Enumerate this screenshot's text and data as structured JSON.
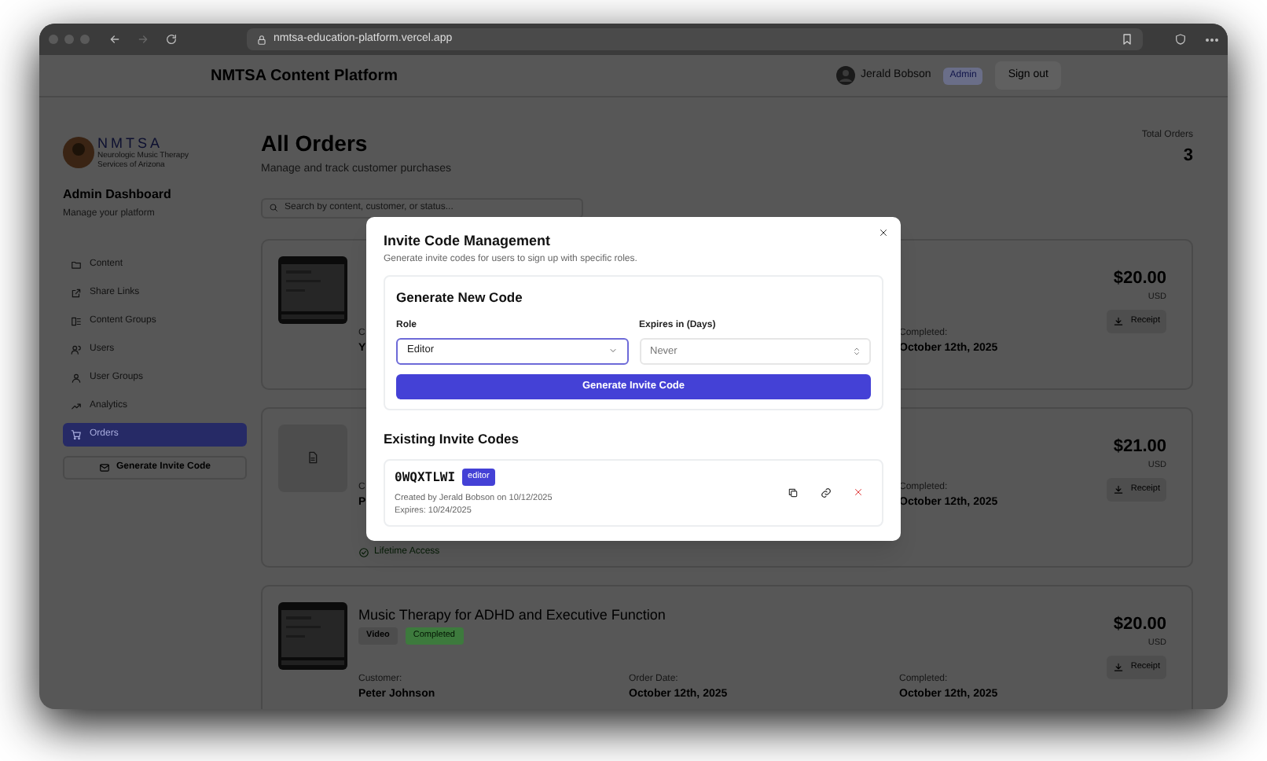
{
  "browser": {
    "url": "nmtsa-education-platform.vercel.app"
  },
  "header": {
    "title": "NMTSA Content Platform",
    "user_name": "Jerald Bobson",
    "role_badge": "Admin",
    "sign_out": "Sign out"
  },
  "sidebar": {
    "logo_text": "NMTSA",
    "logo_subtitle": "Neurologic Music Therapy Services of Arizona",
    "title": "Admin Dashboard",
    "subtitle": "Manage your platform",
    "nav": [
      {
        "label": "Content",
        "selected": false
      },
      {
        "label": "Share Links",
        "selected": false
      },
      {
        "label": "Content Groups",
        "selected": false
      },
      {
        "label": "Users",
        "selected": false
      },
      {
        "label": "User Groups",
        "selected": false
      },
      {
        "label": "Analytics",
        "selected": false
      },
      {
        "label": "Orders",
        "selected": true
      }
    ],
    "invite_button": "Generate Invite Code"
  },
  "page": {
    "title": "All Orders",
    "subtitle": "Manage and track customer purchases",
    "total_label": "Total Orders",
    "total_value": "3",
    "search_placeholder": "Search by content, customer, or status..."
  },
  "orders": [
    {
      "kind": "video",
      "customer_label": "C",
      "customer": "Y",
      "completed_label": "Completed:",
      "completed": "October 12th, 2025",
      "price": "$20.00",
      "currency": "USD",
      "receipt": "Receipt"
    },
    {
      "kind": "document",
      "customer_label": "C",
      "customer": "P",
      "completed_label": "Completed:",
      "completed": "October 12th, 2025",
      "price": "$21.00",
      "currency": "USD",
      "receipt": "Receipt",
      "access": "Lifetime Access"
    },
    {
      "kind": "video",
      "title": "Music Therapy for ADHD and Executive Function",
      "type_badge": "Video",
      "status_badge": "Completed",
      "customer_label": "Customer:",
      "customer": "Peter Johnson",
      "order_date_label": "Order Date:",
      "order_date": "October 12th, 2025",
      "completed_label": "Completed:",
      "completed": "October 12th, 2025",
      "price": "$20.00",
      "currency": "USD",
      "receipt": "Receipt"
    }
  ],
  "modal": {
    "title": "Invite Code Management",
    "description": "Generate invite codes for users to sign up with specific roles.",
    "section_title": "Generate New Code",
    "role_label": "Role",
    "role_value": "Editor",
    "expires_label": "Expires in (Days)",
    "expires_placeholder": "Never",
    "generate_button": "Generate Invite Code",
    "existing_title": "Existing Invite Codes",
    "codes": [
      {
        "code": "0WQXTLWI",
        "role": "editor",
        "created": "Created by Jerald Bobson on 10/12/2025",
        "expires": "Expires: 10/24/2025"
      }
    ]
  }
}
